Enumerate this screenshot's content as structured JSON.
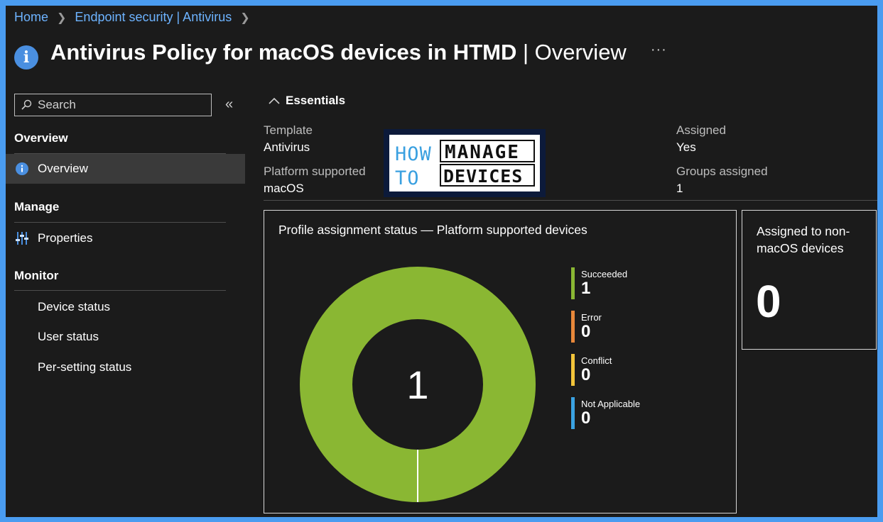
{
  "breadcrumb": {
    "items": [
      "Home",
      "Endpoint security | Antivirus"
    ]
  },
  "page": {
    "title_main": "Antivirus Policy for macOS devices in HTMD",
    "title_sep": " | ",
    "title_sub": "Overview",
    "more": "···"
  },
  "sidebar": {
    "search_placeholder": "Search",
    "collapse": "«",
    "overview_heading": "Overview",
    "overview_item": "Overview",
    "manage_heading": "Manage",
    "properties_item": "Properties",
    "monitor_heading": "Monitor",
    "monitor_items": [
      "Device status",
      "User status",
      "Per-setting status"
    ]
  },
  "essentials": {
    "heading": "Essentials",
    "template_label": "Template",
    "template_value": "Antivirus",
    "platform_label": "Platform supported",
    "platform_value": "macOS",
    "assigned_label": "Assigned",
    "assigned_value": "Yes",
    "groups_label": "Groups assigned",
    "groups_value": "1"
  },
  "logo": {
    "text_line1": "HOW MANAGE",
    "text_line2": "TO DEVICES"
  },
  "profile_card": {
    "title": "Profile assignment status — Platform supported devices",
    "center_value": "1"
  },
  "chart_data": {
    "type": "pie",
    "title": "Profile assignment status — Platform supported devices",
    "center_label": "1",
    "categories": [
      "Succeeded",
      "Error",
      "Conflict",
      "Not Applicable"
    ],
    "values": [
      1,
      0,
      0,
      0
    ],
    "colors": [
      "#8ab733",
      "#e8883a",
      "#f2c43a",
      "#3aa3e3"
    ],
    "legend": [
      {
        "label": "Succeeded",
        "value": "1"
      },
      {
        "label": "Error",
        "value": "0"
      },
      {
        "label": "Conflict",
        "value": "0"
      },
      {
        "label": "Not Applicable",
        "value": "0"
      }
    ]
  },
  "nonmac_card": {
    "title_line1": "Assigned to non-",
    "title_line2": "macOS devices",
    "value": "0"
  }
}
